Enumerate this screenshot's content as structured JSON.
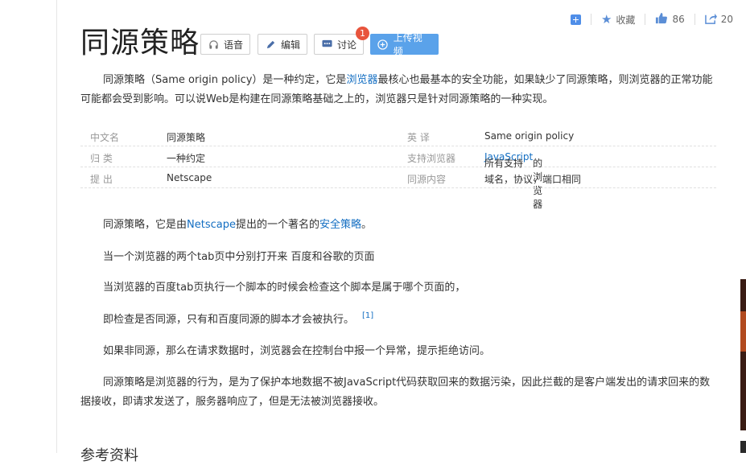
{
  "actions": {
    "favorite_label": "收藏",
    "like_count": "86",
    "share_count": "20"
  },
  "title": "同源策略",
  "title_buttons": {
    "voice": "语音",
    "edit": "编辑",
    "discuss": "讨论",
    "discuss_badge": "1",
    "upload": "上传视频"
  },
  "summary": {
    "part1": "同源策略（Same origin policy）是一种约定，它是",
    "link": "浏览器",
    "part2": "最核心也最基本的安全功能，如果缺少了同源策略，则浏览器的正常功能可能都会受到影响。可以说Web是构建在同源策略基础之上的，浏览器只是针对同源策略的一种实现。"
  },
  "info": {
    "rows": [
      {
        "k1": "中文名",
        "v1": "同源策略",
        "k2": "英    译",
        "v2": "Same origin policy"
      },
      {
        "k1": "归    类",
        "v1": "一种约定",
        "k2": "支持浏览器",
        "v2_pre": "所有支持",
        "v2_link": "JavaScript",
        "v2_post": " 的浏览器"
      },
      {
        "k1": "提    出",
        "v1": "Netscape",
        "k2": "同源内容",
        "v2": "域名，协议，端口相同"
      }
    ]
  },
  "body": {
    "p1_pre": "同源策略，它是由",
    "p1_link1": "Netscape",
    "p1_mid": "提出的一个著名的",
    "p1_link2": "安全策略",
    "p1_post": "。",
    "p2": "当一个浏览器的两个tab页中分别打开来 百度和谷歌的页面",
    "p3": "当浏览器的百度tab页执行一个脚本的时候会检查这个脚本是属于哪个页面的，",
    "p4": "即检查是否同源，只有和百度同源的脚本才会被执行。",
    "p4_ref": "[1]",
    "p5": "如果非同源，那么在请求数据时，浏览器会在控制台中报一个异常，提示拒绝访问。",
    "p6": "同源策略是浏览器的行为，是为了保护本地数据不被JavaScript代码获取回来的数据污染，因此拦截的是客户端发出的请求回来的数据接收，即请求发送了，服务器响应了，但是无法被浏览器接收。"
  },
  "references_heading": "参考资料",
  "colors": {
    "link": "#136ec2",
    "upload_button": "#5aa2ea",
    "badge": "#e8543c",
    "icon_blue": "#4f8ee8"
  }
}
